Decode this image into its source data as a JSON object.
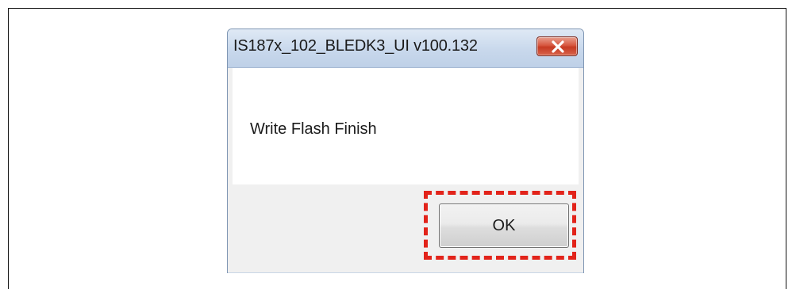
{
  "dialog": {
    "title": "IS187x_102_BLEDK3_UI v100.132",
    "close_icon": "close-x-icon",
    "message": "Write Flash Finish",
    "ok_label": "OK"
  },
  "annotation": {
    "highlight": "ok-button",
    "highlight_color": "#e2231a"
  },
  "colors": {
    "close_button": "#d7573f",
    "titlebar": "#c8d8ec"
  }
}
